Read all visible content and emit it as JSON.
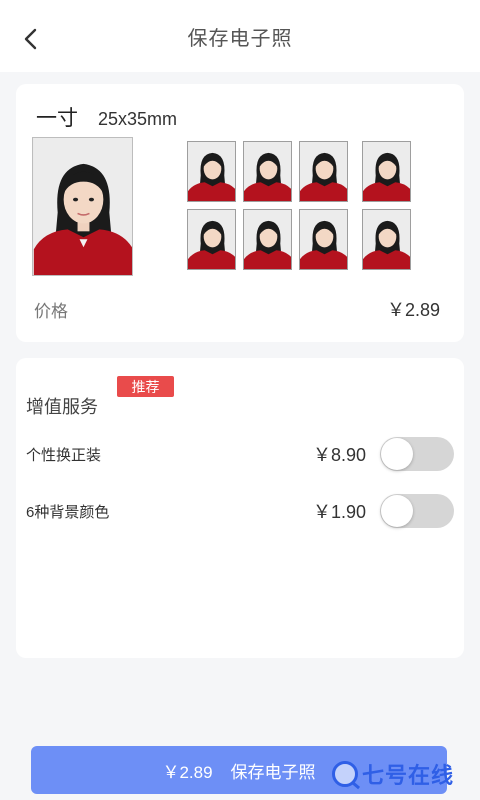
{
  "header": {
    "title": "保存电子照"
  },
  "photo": {
    "spec_name": "一寸",
    "spec_size": "25x35mm",
    "price_label": "价格",
    "price_value": "￥2.89"
  },
  "services": {
    "title": "增值服务",
    "badge": "推荐",
    "items": [
      {
        "name": "个性换正装",
        "price": "￥8.90",
        "enabled": false
      },
      {
        "name": "6种背景颜色",
        "price": "￥1.90",
        "enabled": false
      }
    ]
  },
  "footer": {
    "amount": "￥2.89",
    "label": "保存电子照",
    "accent": "#6d8ff6"
  },
  "watermark": {
    "text": "七号在线"
  },
  "colors": {
    "badge": "#e94b4b",
    "toggle_off": "#d6d6d6",
    "shirt": "#b4121e"
  }
}
